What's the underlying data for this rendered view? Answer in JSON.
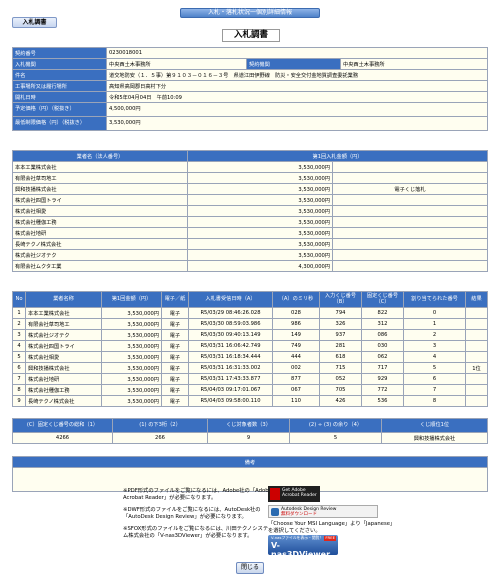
{
  "header": {
    "banner": "入札・落札状況一個別詳細情報",
    "tab": "入札調書",
    "title": "入札調書"
  },
  "info": {
    "contract_no_label": "契約番号",
    "contract_no": "0230018001",
    "org_label": "入札機関",
    "org": "中央西土木事務所",
    "contract_org_label": "契約機関",
    "contract_org": "中央西土木事務所",
    "project_label": "件名",
    "project": "道交地防安（１．５事）第９１０３－０１６－３号　県道江田伊野線　防災・安全交付金地質調査委託業務",
    "place_label": "工事場所又は履行場所",
    "place": "高知県高岡郡日高村下分",
    "open_date_label": "開札日時",
    "open_date": "令和5年04月04日　午前10:09",
    "est_label": "予定価格（円）（税抜き）",
    "est": "4,500,000円",
    "min_label": "最低制限価格（円）（税抜き）",
    "min": "3,530,000円"
  },
  "bids": {
    "col_name": "業者名（法人番号）",
    "col_amount": "第1回入札金額（円）",
    "rows": [
      {
        "name": "本本工業株式会社",
        "amount": "3,530,000円",
        "note": ""
      },
      {
        "name": "有限会社草司地工",
        "amount": "3,530,000円",
        "note": ""
      },
      {
        "name": "興和技播株式会社",
        "amount": "3,530,000円",
        "note": "電子くじ落札"
      },
      {
        "name": "株式会社四国トライ",
        "amount": "3,530,000円",
        "note": ""
      },
      {
        "name": "株式会社相愛",
        "amount": "3,530,000円",
        "note": ""
      },
      {
        "name": "株式会社種伽工務",
        "amount": "3,530,000円",
        "note": ""
      },
      {
        "name": "株式会社地研",
        "amount": "3,530,000円",
        "note": ""
      },
      {
        "name": "長崎テクノ株式会社",
        "amount": "3,530,000円",
        "note": ""
      },
      {
        "name": "株式会社ジオテク",
        "amount": "3,530,000円",
        "note": ""
      },
      {
        "name": "有限会社ムクタ工業",
        "amount": "4,300,000円",
        "note": ""
      }
    ]
  },
  "detail": {
    "headers": [
      "No",
      "業者名称",
      "第1回金額（円）",
      "電子／紙",
      "入札書受信日時（A）",
      "（A）のミリ秒",
      "入力くじ番号（B）",
      "固定くじ番号（C）",
      "割り当てられた番号",
      "結果"
    ],
    "rows": [
      {
        "no": "1",
        "name": "本本工業株式会社",
        "amount": "3,530,000円",
        "type": "電子",
        "time": "R5/03/29 08:46:26.028",
        "ms": "028",
        "lotB": "794",
        "lotC": "822",
        "assigned": "0",
        "result": ""
      },
      {
        "no": "2",
        "name": "有限会社草司地工",
        "amount": "3,530,000円",
        "type": "電子",
        "time": "R5/03/30 08:59:03.986",
        "ms": "986",
        "lotB": "326",
        "lotC": "312",
        "assigned": "1",
        "result": ""
      },
      {
        "no": "3",
        "name": "株式会社ジオテク",
        "amount": "3,530,000円",
        "type": "電子",
        "time": "R5/03/30 09:40:13.149",
        "ms": "149",
        "lotB": "937",
        "lotC": "086",
        "assigned": "2",
        "result": ""
      },
      {
        "no": "4",
        "name": "株式会社四国トライ",
        "amount": "3,530,000円",
        "type": "電子",
        "time": "R5/03/31 16:06:42.749",
        "ms": "749",
        "lotB": "281",
        "lotC": "030",
        "assigned": "3",
        "result": ""
      },
      {
        "no": "5",
        "name": "株式会社相愛",
        "amount": "3,530,000円",
        "type": "電子",
        "time": "R5/03/31 16:18:34.444",
        "ms": "444",
        "lotB": "618",
        "lotC": "062",
        "assigned": "4",
        "result": ""
      },
      {
        "no": "6",
        "name": "興和技播株式会社",
        "amount": "3,530,000円",
        "type": "電子",
        "time": "R5/03/31 16:31:33.002",
        "ms": "002",
        "lotB": "715",
        "lotC": "717",
        "assigned": "5",
        "result": "1位"
      },
      {
        "no": "7",
        "name": "株式会社地研",
        "amount": "3,530,000円",
        "type": "電子",
        "time": "R5/03/31 17:43:33.877",
        "ms": "877",
        "lotB": "052",
        "lotC": "929",
        "assigned": "6",
        "result": ""
      },
      {
        "no": "8",
        "name": "株式会社種伽工務",
        "amount": "3,530,000円",
        "type": "電子",
        "time": "R5/04/03 09:17:01.067",
        "ms": "067",
        "lotB": "705",
        "lotC": "772",
        "assigned": "7",
        "result": ""
      },
      {
        "no": "9",
        "name": "長崎テクノ株式会社",
        "amount": "3,530,000円",
        "type": "電子",
        "time": "R5/04/03 09:58:00.110",
        "ms": "110",
        "lotB": "426",
        "lotC": "536",
        "assigned": "8",
        "result": ""
      }
    ]
  },
  "summary": {
    "headers": [
      "(C）固定くじ番号の総和（1）",
      "(1) の下3桁（2）",
      "くじ対象者数（3）",
      "(2) ÷ (3) の余り（4）",
      "くじ順位1位"
    ],
    "values": [
      "4266",
      "266",
      "9",
      "5",
      "興和技播株式会社"
    ]
  },
  "remarks": {
    "label": "備考",
    "text": ""
  },
  "notes": {
    "pdf": "※PDF形式のファイルをご覧になるには、Adobe社の「Adobe Acrobat Reader」が必要になります。",
    "dwf": "※DWF形式のファイルをご覧になるには、AutoDesk社の「AutoDesk Design Review」が必要になります。",
    "sfx": "※SFOX形式のファイルをご覧になるには、川田テクノシステム株式会社の「V-nas3DViewer」が必要になります。",
    "pdf_badge_line1": "Get Adobe",
    "pdf_badge_line2": "Acrobat Reader",
    "dw_badge_line1": "Autodesk Design Review",
    "dw_badge_line2": "無料ダウンロード",
    "dw_note": "「Choose Your MSI Language」より「Japanese」を選択してください。",
    "v_small": "V-nasファイルを表示・閲覧！",
    "v_big": "V-nas3DViewer",
    "v_free": "FREE",
    "v_dl": "ダウンロードはこちら"
  },
  "footer": {
    "close": "閉じる"
  }
}
